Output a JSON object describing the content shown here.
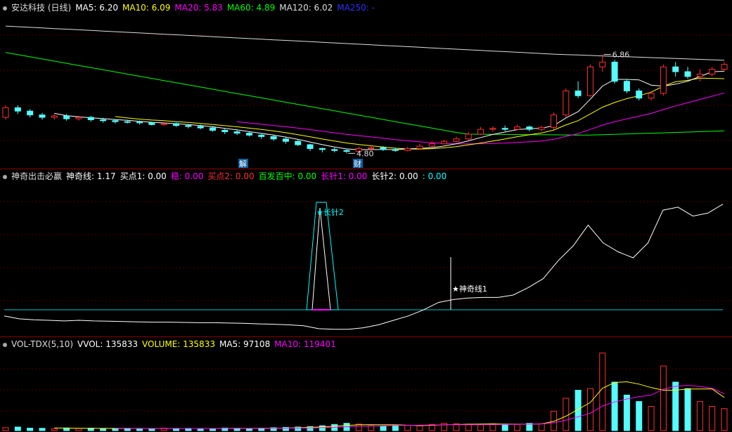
{
  "price_panel": {
    "stock": "安达科技 (日线)",
    "ma_labels": [
      {
        "text": "MA5: 6.20",
        "color": "#ffffff"
      },
      {
        "text": "MA10: 6.09",
        "color": "#ffff00"
      },
      {
        "text": "MA20: 5.83",
        "color": "#ff00ff"
      },
      {
        "text": "MA60: 4.89",
        "color": "#00ff00"
      },
      {
        "text": "MA120: 6.02",
        "color": "#dddddd"
      },
      {
        "text": "MA250: -",
        "color": "#3030ff"
      }
    ],
    "high_label": "6.86",
    "low_label": "4.80",
    "marker_jie": "解",
    "marker_cai": "财"
  },
  "indicator_panel": {
    "name": "神奇出击必赢",
    "labels": [
      {
        "text": "神奇线: 1.17",
        "color": "#ffffff"
      },
      {
        "text": "买点1: 0.00",
        "color": "#ffffff"
      },
      {
        "text": "稳: 0.00",
        "color": "#ff00ff"
      },
      {
        "text": "买点2: 0.00",
        "color": "#ff3030"
      },
      {
        "text": "百发百中: 0.00",
        "color": "#00ff00"
      },
      {
        "text": "长针1: 0.00",
        "color": "#ff00ff"
      },
      {
        "text": "长针2: 0.00",
        "color": "#ffffff"
      },
      {
        "text": ": 0.00",
        "color": "#00ffff"
      }
    ],
    "signal1": "★神奇线1",
    "signal2": "★长针2"
  },
  "volume_panel": {
    "name": "VOL-TDX(5,10)",
    "labels": [
      {
        "text": "VVOL: 135833",
        "color": "#ffffff"
      },
      {
        "text": "VOLUME: 135833",
        "color": "#ffff00"
      },
      {
        "text": "MA5: 97108",
        "color": "#ffffff"
      },
      {
        "text": "MA10: 119401",
        "color": "#ff00ff"
      }
    ]
  },
  "colors": {
    "up": "#ff3030",
    "down": "#54fcfc",
    "ma5": "#ffffff",
    "ma10": "#ffff00",
    "ma20": "#ff00ff",
    "ma60": "#00ff00",
    "ma120": "#dddddd"
  },
  "chart_data": {
    "type": "candlestick",
    "n_bars": 60,
    "price_range": [
      4.6,
      7.7
    ],
    "candles": [
      [
        5.55,
        5.75,
        5.5,
        5.8
      ],
      [
        5.75,
        5.68,
        5.62,
        5.8
      ],
      [
        5.68,
        5.6,
        5.55,
        5.72
      ],
      [
        5.6,
        5.55,
        5.5,
        5.64
      ],
      [
        5.55,
        5.58,
        5.5,
        5.62
      ],
      [
        5.58,
        5.52,
        5.48,
        5.62
      ],
      [
        5.52,
        5.55,
        5.48,
        5.58
      ],
      [
        5.55,
        5.5,
        5.46,
        5.58
      ],
      [
        5.5,
        5.48,
        5.44,
        5.54
      ],
      [
        5.48,
        5.46,
        5.42,
        5.52
      ],
      [
        5.46,
        5.45,
        5.42,
        5.5
      ],
      [
        5.45,
        5.44,
        5.4,
        5.48
      ],
      [
        5.44,
        5.4,
        5.38,
        5.46
      ],
      [
        5.4,
        5.42,
        5.37,
        5.45
      ],
      [
        5.42,
        5.38,
        5.35,
        5.44
      ],
      [
        5.38,
        5.36,
        5.32,
        5.41
      ],
      [
        5.36,
        5.33,
        5.3,
        5.4
      ],
      [
        5.33,
        5.28,
        5.25,
        5.35
      ],
      [
        5.28,
        5.25,
        5.2,
        5.32
      ],
      [
        5.25,
        5.22,
        5.18,
        5.28
      ],
      [
        5.22,
        5.18,
        5.15,
        5.25
      ],
      [
        5.18,
        5.15,
        5.1,
        5.22
      ],
      [
        5.15,
        5.1,
        5.06,
        5.18
      ],
      [
        5.1,
        5.05,
        5.0,
        5.14
      ],
      [
        5.05,
        4.98,
        4.95,
        5.08
      ],
      [
        4.98,
        4.9,
        4.85,
        5.0
      ],
      [
        4.9,
        4.88,
        4.82,
        4.92
      ],
      [
        4.88,
        4.86,
        4.82,
        4.92
      ],
      [
        4.86,
        4.84,
        4.8,
        4.9
      ],
      [
        4.84,
        4.9,
        4.8,
        4.94
      ],
      [
        4.9,
        4.92,
        4.86,
        4.96
      ],
      [
        4.92,
        4.88,
        4.85,
        4.95
      ],
      [
        4.88,
        4.86,
        4.83,
        4.92
      ],
      [
        4.86,
        4.9,
        4.84,
        4.94
      ],
      [
        4.9,
        4.95,
        4.88,
        5.0
      ],
      [
        4.95,
        5.0,
        4.92,
        5.05
      ],
      [
        5.0,
        5.05,
        4.98,
        5.08
      ],
      [
        5.05,
        5.1,
        5.02,
        5.15
      ],
      [
        5.1,
        5.2,
        5.08,
        5.25
      ],
      [
        5.2,
        5.3,
        5.18,
        5.35
      ],
      [
        5.3,
        5.32,
        5.25,
        5.36
      ],
      [
        5.32,
        5.3,
        5.26,
        5.38
      ],
      [
        5.3,
        5.35,
        5.28,
        5.4
      ],
      [
        5.35,
        5.3,
        5.26,
        5.38
      ],
      [
        5.3,
        5.34,
        5.26,
        5.38
      ],
      [
        5.34,
        5.6,
        5.3,
        5.65
      ],
      [
        5.6,
        6.1,
        5.55,
        6.15
      ],
      [
        6.1,
        6.0,
        5.95,
        6.3
      ],
      [
        6.0,
        6.6,
        5.98,
        6.65
      ],
      [
        6.6,
        6.7,
        6.5,
        6.86
      ],
      [
        6.7,
        6.3,
        6.25,
        6.75
      ],
      [
        6.3,
        6.1,
        6.05,
        6.35
      ],
      [
        6.1,
        5.95,
        5.9,
        6.15
      ],
      [
        5.95,
        6.05,
        5.9,
        6.1
      ],
      [
        6.05,
        6.6,
        6.0,
        6.65
      ],
      [
        6.6,
        6.5,
        6.4,
        6.7
      ],
      [
        6.5,
        6.4,
        6.35,
        6.6
      ],
      [
        6.4,
        6.45,
        6.3,
        6.55
      ],
      [
        6.45,
        6.55,
        6.4,
        6.6
      ],
      [
        6.55,
        6.65,
        6.5,
        6.7
      ]
    ],
    "volume_range": [
      0,
      500000
    ],
    "volume": [
      18000,
      22000,
      15000,
      14000,
      12000,
      16000,
      13000,
      15000,
      12000,
      11000,
      14000,
      13000,
      12000,
      15000,
      12000,
      14000,
      13000,
      12000,
      16000,
      14000,
      12000,
      15000,
      18000,
      20000,
      22000,
      25000,
      30000,
      38000,
      45000,
      40000,
      30000,
      28000,
      35000,
      32000,
      30000,
      38000,
      45000,
      42000,
      40000,
      38000,
      42000,
      40000,
      38000,
      45000,
      42000,
      120000,
      200000,
      250000,
      260000,
      480000,
      300000,
      220000,
      180000,
      150000,
      400000,
      300000,
      260000,
      180000,
      150000,
      135833
    ],
    "indicator_range": [
      0,
      5
    ],
    "magic_line": [
      0.55,
      0.45,
      0.42,
      0.4,
      0.38,
      0.4,
      0.38,
      0.37,
      0.36,
      0.35,
      0.34,
      0.34,
      0.33,
      0.32,
      0.32,
      0.31,
      0.3,
      0.28,
      0.27,
      0.25,
      0.22,
      0.12,
      0.1,
      0.1,
      0.15,
      0.25,
      0.4,
      0.55,
      0.75,
      1.0,
      1.1,
      1.15,
      1.17,
      1.17,
      1.25,
      1.5,
      1.8,
      2.4,
      2.9,
      3.6,
      3.0,
      2.7,
      2.5,
      3.0,
      4.1,
      4.2,
      3.9,
      4.0,
      4.3
    ]
  }
}
